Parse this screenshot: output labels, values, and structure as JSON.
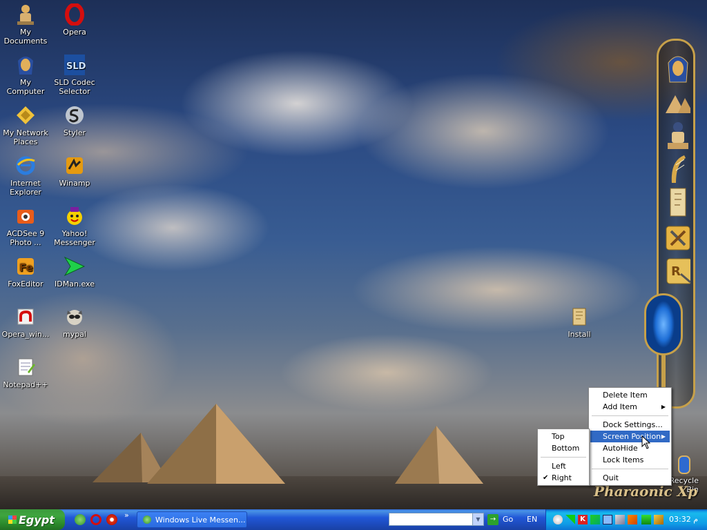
{
  "desktop": {
    "icons": [
      {
        "label": "My Documents",
        "icon": "pharaoh-scribe-icon"
      },
      {
        "label": "Opera",
        "icon": "opera-icon"
      },
      {
        "label": "My Computer",
        "icon": "pharaoh-mask-icon"
      },
      {
        "label": "SLD Codec Selector",
        "icon": "sld-icon"
      },
      {
        "label": "My Network Places",
        "icon": "network-icon"
      },
      {
        "label": "Styler",
        "icon": "styler-icon"
      },
      {
        "label": "Internet Explorer",
        "icon": "ie-icon"
      },
      {
        "label": "Winamp",
        "icon": "winamp-icon"
      },
      {
        "label": "ACDSee 9 Photo ...",
        "icon": "acdsee-icon"
      },
      {
        "label": "Yahoo! Messenger",
        "icon": "yahoo-icon"
      },
      {
        "label": "FoxEditor",
        "icon": "foxeditor-icon"
      },
      {
        "label": "IDMan.exe",
        "icon": "idman-icon"
      },
      {
        "label": "Opera_win...",
        "icon": "opera-installer-icon"
      },
      {
        "label": "mypal",
        "icon": "mypal-icon"
      },
      {
        "label": "Notepad++",
        "icon": "notepad-icon"
      },
      {
        "label": "Install",
        "icon": "install-icon"
      },
      {
        "label": "Recycle Bin",
        "icon": "recycle-bin-icon"
      }
    ],
    "watermark": "Pharaonic Xp"
  },
  "dock": {
    "items": [
      "pharaoh-mask-icon",
      "pyramids-icon",
      "scribe-icon",
      "harp-icon",
      "papyrus-icon",
      "tools-icon",
      "r-tools-icon",
      "cartouche-icon"
    ]
  },
  "context_menu": {
    "items": [
      {
        "label": "Delete Item"
      },
      {
        "label": "Add Item",
        "submenu": true
      },
      {
        "label": "Dock Settings..."
      },
      {
        "label": "Screen Position",
        "submenu": true,
        "highlighted": true
      },
      {
        "label": "AutoHide"
      },
      {
        "label": "Lock Items"
      },
      {
        "label": "Quit"
      }
    ]
  },
  "submenu": {
    "items": [
      {
        "label": "Top",
        "checked": false
      },
      {
        "label": "Bottom",
        "checked": false
      },
      {
        "label": "Left",
        "checked": false
      },
      {
        "label": "Right",
        "checked": true
      }
    ]
  },
  "taskbar": {
    "start_label": "Egypt",
    "quick_launch": [
      "messenger-icon",
      "opera-icon",
      "stop-icon"
    ],
    "overflow": "»",
    "tasks": [
      {
        "label": "Windows Live Messen...",
        "icon": "messenger-icon"
      }
    ],
    "address_value": "",
    "go_label": "Go",
    "language": "EN",
    "time": "03:32",
    "time_suffix": "م"
  },
  "colors": {
    "menu_highlight": "#316ac5",
    "taskbar": "#2157d7",
    "start": "#3ea53e",
    "tray": "#109ce6",
    "dock_border": "#c6a04a"
  }
}
